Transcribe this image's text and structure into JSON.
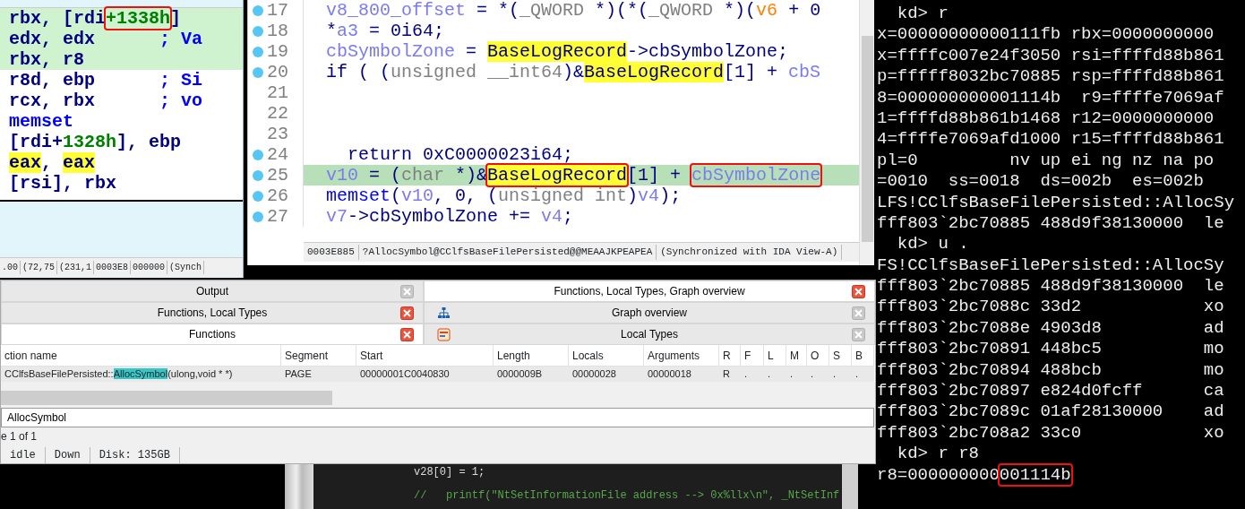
{
  "disassembly": {
    "lines": [
      {
        "highlighted": true,
        "segments": [
          {
            "text": "rbx, [rdi",
            "kind": "text"
          },
          {
            "text": "+1338h",
            "kind": "num",
            "boxed": true
          },
          {
            "text": "]",
            "kind": "text"
          }
        ]
      },
      {
        "highlighted": true,
        "segments": [
          {
            "text": "edx, edx",
            "kind": "text"
          },
          {
            "text": "      ; Va",
            "kind": "kw"
          }
        ]
      },
      {
        "highlighted": true,
        "segments": [
          {
            "text": "rbx, r8",
            "kind": "text"
          }
        ]
      },
      {
        "highlighted": false,
        "segments": [
          {
            "text": "r8d, ebp",
            "kind": "text"
          },
          {
            "text": "      ; Si",
            "kind": "kw"
          }
        ]
      },
      {
        "highlighted": false,
        "segments": [
          {
            "text": "rcx, rbx",
            "kind": "text"
          },
          {
            "text": "      ; vo",
            "kind": "kw"
          }
        ]
      },
      {
        "highlighted": false,
        "segments": [
          {
            "text": "memset",
            "kind": "kw"
          }
        ]
      },
      {
        "highlighted": false,
        "segments": [
          {
            "text": "[rdi+",
            "kind": "text"
          },
          {
            "text": "1328h",
            "kind": "num"
          },
          {
            "text": "], ebp",
            "kind": "text"
          }
        ]
      },
      {
        "highlighted": false,
        "segments": [
          {
            "text": "eax",
            "kind": "mark"
          },
          {
            "text": ", ",
            "kind": "text"
          },
          {
            "text": "eax",
            "kind": "mark"
          }
        ]
      },
      {
        "highlighted": false,
        "segments": [
          {
            "text": "[rsi], rbx",
            "kind": "text"
          }
        ]
      }
    ],
    "status": [
      ".00",
      "(72,75",
      "(231,1",
      "0003E8",
      "000000",
      "(Synch"
    ]
  },
  "pseudocode": {
    "lines": [
      {
        "number": "17",
        "breakpoint": true,
        "selected": false,
        "segments": [
          {
            "text": "v8_800_offset",
            "kind": "var"
          },
          {
            "text": " = *(",
            "kind": "text"
          },
          {
            "text": "_QWORD",
            "kind": "type"
          },
          {
            "text": " *)(*(",
            "kind": "text"
          },
          {
            "text": "_QWORD",
            "kind": "type"
          },
          {
            "text": " *)(",
            "kind": "text"
          },
          {
            "text": "v6",
            "kind": "arg"
          },
          {
            "text": " + 0",
            "kind": "text"
          }
        ]
      },
      {
        "number": "18",
        "breakpoint": true,
        "selected": false,
        "segments": [
          {
            "text": "*",
            "kind": "text"
          },
          {
            "text": "a3",
            "kind": "var"
          },
          {
            "text": " = 0i64;",
            "kind": "text"
          }
        ]
      },
      {
        "number": "19",
        "breakpoint": true,
        "selected": false,
        "segments": [
          {
            "text": "cbSymbolZone",
            "kind": "var"
          },
          {
            "text": " = ",
            "kind": "text"
          },
          {
            "text": "BaseLogRecord",
            "kind": "mark"
          },
          {
            "text": "->cbSymbolZone;",
            "kind": "text"
          }
        ]
      },
      {
        "number": "20",
        "breakpoint": true,
        "selected": false,
        "segments": [
          {
            "text": "if ( (",
            "kind": "text"
          },
          {
            "text": "unsigned __int64",
            "kind": "type"
          },
          {
            "text": ")&",
            "kind": "text"
          },
          {
            "text": "BaseLogRecord",
            "kind": "mark"
          },
          {
            "text": "[1] + ",
            "kind": "text"
          },
          {
            "text": "cbS",
            "kind": "var"
          }
        ]
      },
      {
        "number": "21",
        "breakpoint": false,
        "selected": false
      },
      {
        "number": "22",
        "breakpoint": false,
        "selected": false
      },
      {
        "number": "23",
        "breakpoint": false,
        "selected": false
      },
      {
        "number": "24",
        "breakpoint": true,
        "selected": false,
        "segments": [
          {
            "text": "  return 0xC0000023i64;",
            "kind": "text"
          }
        ]
      },
      {
        "number": "25",
        "breakpoint": true,
        "selected": true,
        "segments": [
          {
            "text": "v10",
            "kind": "var"
          },
          {
            "text": " = (",
            "kind": "text"
          },
          {
            "text": "char",
            "kind": "type"
          },
          {
            "text": " *)&",
            "kind": "text"
          },
          {
            "text": "BaseLogRecord",
            "kind": "mark",
            "boxed": true
          },
          {
            "text": "[1] + ",
            "kind": "text"
          },
          {
            "text": "cbSymbolZone",
            "kind": "var",
            "boxed": true
          }
        ]
      },
      {
        "number": "26",
        "breakpoint": true,
        "selected": false,
        "segments": [
          {
            "text": "memset",
            "kind": "kw"
          },
          {
            "text": "(",
            "kind": "text"
          },
          {
            "text": "v10",
            "kind": "var"
          },
          {
            "text": ", 0, (",
            "kind": "text"
          },
          {
            "text": "unsigned int",
            "kind": "type"
          },
          {
            "text": ")",
            "kind": "text"
          },
          {
            "text": "v4",
            "kind": "var"
          },
          {
            "text": ");",
            "kind": "text"
          }
        ]
      },
      {
        "number": "27",
        "breakpoint": true,
        "selected": false,
        "segments": [
          {
            "text": "v7",
            "kind": "var"
          },
          {
            "text": "->cbSymbolZone += ",
            "kind": "text"
          },
          {
            "text": "v4",
            "kind": "var"
          },
          {
            "text": ";",
            "kind": "text"
          }
        ]
      }
    ],
    "status": [
      "0003E885",
      "?AllocSymbol@CClfsBaseFilePersisted@@MEAAJKPEAPEA",
      "(Synchronized with IDA View-A)"
    ]
  },
  "debugger": {
    "lines": [
      {
        "segments": [
          {
            "text": "  kd> r"
          }
        ]
      },
      {
        "segments": [
          {
            "text": "x=00000000000111fb rbx=0000000000"
          }
        ]
      },
      {
        "segments": [
          {
            "text": "x=ffffc007e24f3050 rsi=ffffd88b861"
          }
        ]
      },
      {
        "segments": [
          {
            "text": "p=fffff8032bc70885 rsp=ffffd88b861"
          }
        ]
      },
      {
        "segments": [
          {
            "text": "8=000000000001114b  r9=ffffe7069af"
          }
        ]
      },
      {
        "segments": [
          {
            "text": "1=ffffd88b861b1468 r12=0000000000"
          }
        ]
      },
      {
        "segments": [
          {
            "text": "4=ffffe7069afd1000 r15=ffffd88b861"
          }
        ]
      },
      {
        "segments": [
          {
            "text": "pl=0         nv up ei ng nz na po"
          }
        ]
      },
      {
        "segments": [
          {
            "text": "=0010  ss=0018  ds=002b  es=002b"
          }
        ]
      },
      {
        "segments": [
          {
            "text": "LFS!CClfsBaseFilePersisted::AllocSy"
          }
        ]
      },
      {
        "segments": [
          {
            "text": "fff803`2bc70885 488d9f38130000  le"
          }
        ]
      },
      {
        "segments": [
          {
            "text": "  kd> u ."
          }
        ]
      },
      {
        "segments": [
          {
            "text": "FS!CClfsBaseFilePersisted::AllocSy"
          }
        ]
      },
      {
        "segments": [
          {
            "text": "fff803`2bc70885 488d9f38130000  le"
          }
        ]
      },
      {
        "segments": [
          {
            "text": "fff803`2bc7088c 33d2            xo"
          }
        ]
      },
      {
        "segments": [
          {
            "text": "fff803`2bc7088e 4903d8          ad"
          }
        ]
      },
      {
        "segments": [
          {
            "text": "fff803`2bc70891 448bc5          mo"
          }
        ]
      },
      {
        "segments": [
          {
            "text": "fff803`2bc70894 488bcb          mo"
          }
        ]
      },
      {
        "segments": [
          {
            "text": "fff803`2bc70897 e824d0fcff      ca"
          }
        ]
      },
      {
        "segments": [
          {
            "text": "fff803`2bc7089c 01af28130000    ad"
          }
        ]
      },
      {
        "segments": [
          {
            "text": "fff803`2bc708a2 33c0            xo"
          }
        ]
      },
      {
        "segments": [
          {
            "text": "  kd> r r8"
          }
        ]
      },
      {
        "segments": [
          {
            "text": "r8=000000000"
          },
          {
            "text": "001114b",
            "boxed": true
          }
        ]
      }
    ]
  },
  "bottom_panel": {
    "tabs_left": [
      {
        "label": "Output",
        "selected": false,
        "focused": false
      },
      {
        "label": "Functions, Local Types",
        "selected": false,
        "focused": true
      },
      {
        "label": "Functions",
        "selected": true,
        "focused": true
      }
    ],
    "tabs_right": [
      {
        "label": "Functions, Local Types, Graph overview",
        "selected": true,
        "focused": true
      },
      {
        "label": "Graph overview",
        "selected": false,
        "focused": false,
        "kind": "graph"
      },
      {
        "label": "Local Types",
        "selected": false,
        "focused": false,
        "kind": "types"
      }
    ],
    "table": {
      "columns": [
        "ction name",
        "Segment",
        "Start",
        "Length",
        "Locals",
        "Arguments",
        "R",
        "F",
        "L",
        "M",
        "O",
        "S",
        "B"
      ],
      "rows": [
        {
          "selected": true,
          "cells": [
            {
              "segments": [
                {
                  "text": "CClfsBaseFilePersisted::",
                  "kind": "plain"
                },
                {
                  "text": "AllocSymbol",
                  "kind": "match"
                },
                {
                  "text": "(ulong,void * *)",
                  "kind": "plain"
                }
              ]
            },
            "PAGE",
            "00000001C0040830",
            "0000009B",
            "00000028",
            "00000018",
            "R",
            ".",
            ".",
            ".",
            ".",
            ".",
            "."
          ]
        }
      ]
    },
    "filter": {
      "value": "AllocSymbol"
    },
    "footer": "e 1 of 1",
    "status_bar": [
      "idle",
      "Down",
      "Disk: 135GB"
    ]
  },
  "background_code": {
    "lines": [
      {
        "text": "v28[0] = 1;",
        "kind": "code"
      },
      {
        "text": "//   printf(\"NtSetInformationFile address --> 0x%llx\\n\", _NtSetInf",
        "kind": "comment"
      }
    ]
  }
}
